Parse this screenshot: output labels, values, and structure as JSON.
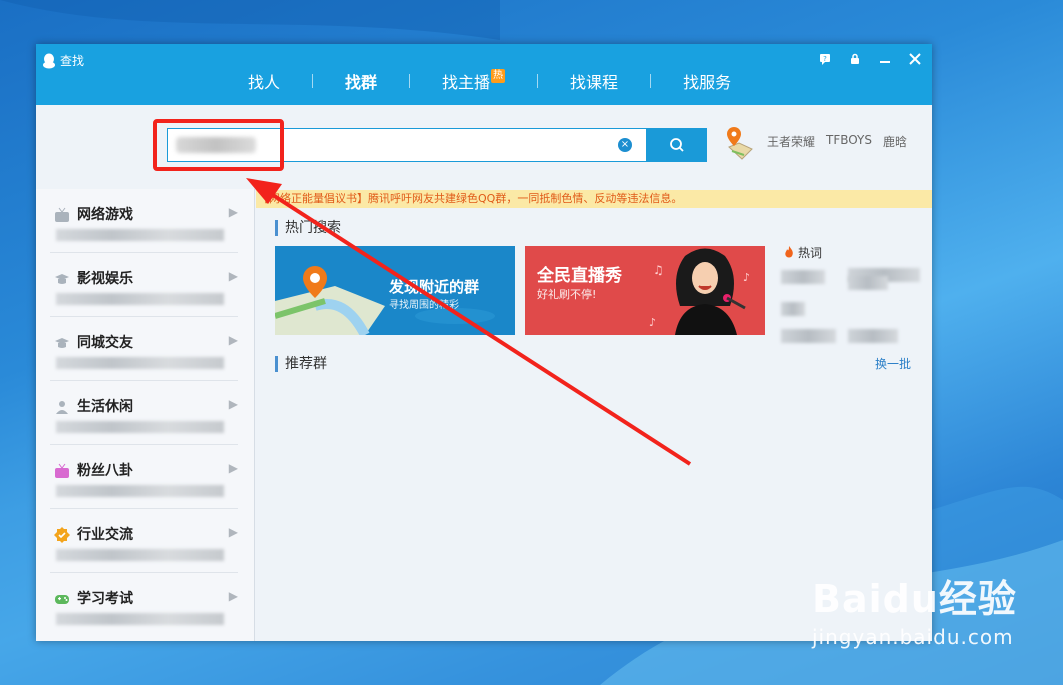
{
  "window": {
    "title": "查找",
    "tabs": [
      {
        "label": "找人"
      },
      {
        "label": "找群"
      },
      {
        "label": "找主播",
        "badge": "热"
      },
      {
        "label": "找课程"
      },
      {
        "label": "找服务"
      }
    ],
    "active_tab": "找群",
    "titlebar_buttons": [
      "feedback-icon",
      "lock-icon",
      "minimize-icon",
      "close-icon"
    ]
  },
  "search": {
    "value": "",
    "hotwords": [
      "王者荣耀",
      "TFBOYS",
      "鹿晗"
    ]
  },
  "notice": "【网络正能量倡议书】腾讯呼吁网友共建绿色QQ群，一同抵制色情、反动等违法信息。",
  "sidebar": {
    "categories": [
      {
        "label": "网络游戏",
        "icon": "tv-icon"
      },
      {
        "label": "影视娱乐",
        "icon": "graduation-cap-icon"
      },
      {
        "label": "同城交友",
        "icon": "graduation-cap-icon"
      },
      {
        "label": "生活休闲",
        "icon": "person-icon"
      },
      {
        "label": "粉丝八卦",
        "icon": "tv-pink-icon"
      },
      {
        "label": "行业交流",
        "icon": "badge-check-icon"
      },
      {
        "label": "学习考试",
        "icon": "gamepad-icon"
      }
    ]
  },
  "main": {
    "hot_search_title": "热门搜索",
    "banners": [
      {
        "title": "发现附近的群",
        "subtitle": "寻找周围的精彩"
      },
      {
        "title": "全民直播秀",
        "subtitle": "好礼刷不停!"
      }
    ],
    "hotwords_title": "热词",
    "recommended_title": "推荐群",
    "change_batch": "换一批"
  },
  "watermark": {
    "brand": "Baidu经验",
    "url": "jingyan.baidu.com"
  },
  "colors": {
    "titlebar": "#19a1e0",
    "annotation_red": "#f2231c",
    "notice_bg": "#fbe9a6",
    "notice_text": "#e05a18"
  }
}
